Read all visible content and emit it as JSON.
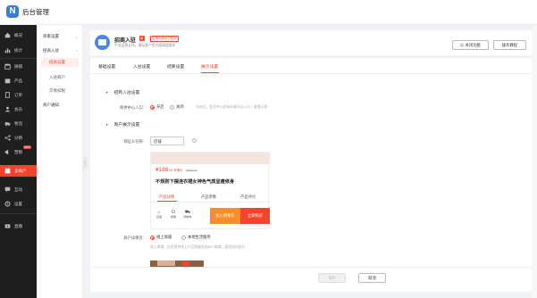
{
  "app": {
    "logo_letter": "N",
    "title": "后台管理"
  },
  "colors": {
    "accent": "#f5442d",
    "sidebar_bg": "#1f1f1f",
    "orange": "#fa8c2b",
    "blue": "#4a86e8"
  },
  "sidebar": {
    "items": [
      {
        "label": "概况",
        "icon": "home-icon"
      },
      {
        "label": "统计",
        "icon": "chart-icon"
      },
      {
        "label": "微铺",
        "icon": "store-icon"
      },
      {
        "label": "产品",
        "icon": "box-icon"
      },
      {
        "label": "订单",
        "icon": "order-icon"
      },
      {
        "label": "会员",
        "icon": "member-icon"
      },
      {
        "label": "物流",
        "icon": "truck-icon"
      },
      {
        "label": "分销",
        "icon": "share-icon"
      },
      {
        "label": "营销",
        "icon": "megaphone-icon",
        "badge": "NEW"
      },
      {
        "label": "多商户",
        "icon": "shop-icon"
      },
      {
        "label": "互动",
        "icon": "chat-icon"
      },
      {
        "label": "设置",
        "icon": "gear-icon"
      },
      {
        "label": "直播",
        "icon": "live-icon"
      }
    ]
  },
  "subnav": {
    "group1": "商家设置",
    "group2": "招商入驻",
    "subs": [
      "招商设置",
      "入驻商户",
      "交易扣税"
    ],
    "group3": "商户通知"
  },
  "header": {
    "title": "招商入驻",
    "tag": "新",
    "tag2": "应用标准价已购买",
    "desc": "平台运营全场，满足客户多方面网络需求",
    "close_btn": "关闭功能",
    "help_btn": "操作教程"
  },
  "tabs": [
    "基础设置",
    "入驻设置",
    "结算设置",
    "展示设置"
  ],
  "section1": {
    "title": "招商入驻设置",
    "label": "商供中心入口:",
    "opt_on": "开启",
    "opt_off": "关闭",
    "hint": "开启后，会员中心会有申请开店入口 □ 查看示例"
  },
  "section2": {
    "title": "商户展示设置",
    "alias_label": "商征义名称:",
    "alias_value": "店铺",
    "help": "?"
  },
  "preview": {
    "price": "¥188",
    "price_dec": ".00 专享价",
    "orig": "¥288.00",
    "name": "不规则下摆连衣裙女神色气质显瘦修身",
    "tabs": [
      "产品详情",
      "产品参数",
      "产品评论"
    ],
    "icons": [
      {
        "glyph": "⌂",
        "label": "店铺"
      },
      {
        "glyph": "☊",
        "label": "客服"
      },
      {
        "glyph": "⛟",
        "label": "购物车"
      }
    ],
    "btn_cart": "加入购物车",
    "btn_buy": "立即购买"
  },
  "display": {
    "label": "商户详情页:",
    "opt1": "线上商铺",
    "opt2": "本地生活服务",
    "hint": "线上商铺，适合提供线上产品和服务的B2C商城，表现如何部分"
  },
  "footer": {
    "save": "保存",
    "cancel": "取消"
  }
}
